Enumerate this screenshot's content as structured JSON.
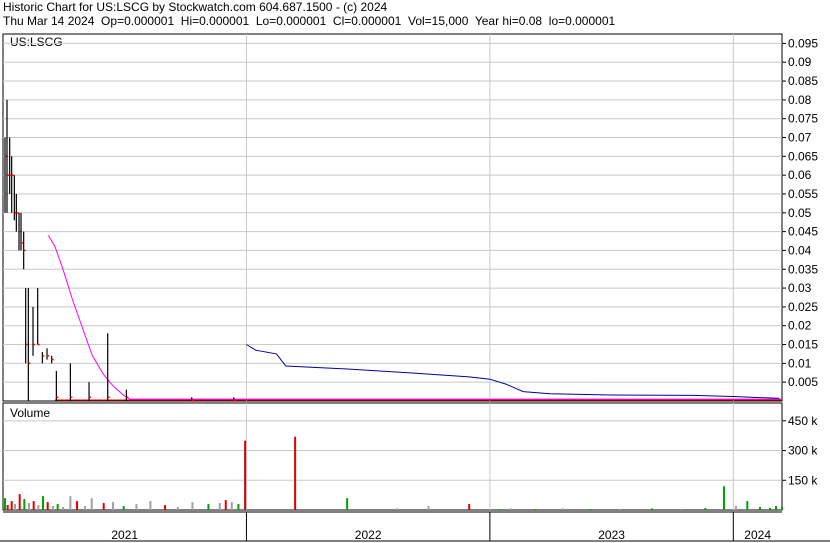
{
  "header": {
    "title": "Historic Chart for US:LSCG by Stockwatch.com 604.687.1500 - (c) 2024",
    "quote": "Thu Mar 14 2024  Op=0.000001  Hi=0.000001  Lo=0.000001  Cl=0.000001  Vol=15,000  Year hi=0.08  lo=0.000001"
  },
  "chart_data": {
    "type": "candlestick",
    "symbol_label": "US:LSCG",
    "volume_label": "Volume",
    "x_ticks": [
      "2021",
      "2022",
      "2023",
      "2024"
    ],
    "x_range": [
      "2021-01-01",
      "2024-03-14"
    ],
    "price_axis": {
      "ticks": [
        0.005,
        0.01,
        0.015,
        0.02,
        0.025,
        0.03,
        0.035,
        0.04,
        0.045,
        0.05,
        0.055,
        0.06,
        0.065,
        0.07,
        0.075,
        0.08,
        0.085,
        0.09,
        0.095
      ],
      "tick_labels": [
        "0.005",
        "0.01",
        "0.015",
        "0.02",
        "0.025",
        "0.03",
        "0.035",
        "0.04",
        "0.045",
        "0.05",
        "0.055",
        "0.06",
        "0.065",
        "0.07",
        "0.075",
        "0.08",
        "0.085",
        "0.09",
        "0.095"
      ],
      "ylim": [
        0,
        0.0975
      ]
    },
    "volume_axis": {
      "ticks": [
        150000,
        300000,
        450000
      ],
      "tick_labels": [
        "150 k",
        "300 k",
        "450 k"
      ],
      "ylim": [
        0,
        540000
      ]
    },
    "grid": true,
    "colors": {
      "bar": "#000000",
      "close_tick": "#ff0000",
      "ma_short": "#ff00ff",
      "ma_long": "#0000a0",
      "vol_up": "#00a000",
      "vol_down": "#e00000",
      "vol_flat": "#a0a0a0",
      "grid": "#c8c8c8"
    },
    "price_bars": [
      {
        "date": "2021-01-04",
        "high": 0.07,
        "low": 0.05,
        "close": 0.065
      },
      {
        "date": "2021-01-07",
        "high": 0.08,
        "low": 0.05,
        "close": 0.06
      },
      {
        "date": "2021-01-11",
        "high": 0.07,
        "low": 0.055,
        "close": 0.06
      },
      {
        "date": "2021-01-14",
        "high": 0.065,
        "low": 0.05,
        "close": 0.06
      },
      {
        "date": "2021-01-18",
        "high": 0.06,
        "low": 0.048,
        "close": 0.05
      },
      {
        "date": "2021-01-21",
        "high": 0.055,
        "low": 0.045,
        "close": 0.05
      },
      {
        "date": "2021-01-25",
        "high": 0.05,
        "low": 0.04,
        "close": 0.045
      },
      {
        "date": "2021-01-28",
        "high": 0.05,
        "low": 0.04,
        "close": 0.042
      },
      {
        "date": "2021-02-01",
        "high": 0.045,
        "low": 0.035,
        "close": 0.04
      },
      {
        "date": "2021-02-04",
        "high": 0.03,
        "low": 0.01,
        "close": 0.015
      },
      {
        "date": "2021-02-08",
        "high": 0.03,
        "low": 1e-06,
        "close": 0.01
      },
      {
        "date": "2021-02-15",
        "high": 0.025,
        "low": 0.012,
        "close": 0.015
      },
      {
        "date": "2021-02-22",
        "high": 0.03,
        "low": 0.015,
        "close": 0.015
      },
      {
        "date": "2021-03-01",
        "high": 0.013,
        "low": 0.01,
        "close": 0.012
      },
      {
        "date": "2021-03-08",
        "high": 0.014,
        "low": 0.011,
        "close": 0.012
      },
      {
        "date": "2021-03-15",
        "high": 0.012,
        "low": 0.01,
        "close": 0.011
      },
      {
        "date": "2021-03-22",
        "high": 0.008,
        "low": 1e-06,
        "close": 0.001
      },
      {
        "date": "2021-04-12",
        "high": 0.01,
        "low": 1e-06,
        "close": 0.001
      },
      {
        "date": "2021-05-10",
        "high": 0.005,
        "low": 1e-06,
        "close": 0.001
      },
      {
        "date": "2021-06-07",
        "high": 0.018,
        "low": 1e-06,
        "close": 0.001
      },
      {
        "date": "2021-07-05",
        "high": 0.003,
        "low": 1e-06,
        "close": 0.001
      },
      {
        "date": "2021-10-11",
        "high": 0.001,
        "low": 1e-06,
        "close": 1e-06
      },
      {
        "date": "2021-12-13",
        "high": 0.001,
        "low": 1e-06,
        "close": 1e-06
      }
    ],
    "flat_price": 1e-06,
    "ma_short": [
      {
        "date": "2021-03-10",
        "value": 0.044
      },
      {
        "date": "2021-03-20",
        "value": 0.041
      },
      {
        "date": "2021-04-01",
        "value": 0.035
      },
      {
        "date": "2021-04-15",
        "value": 0.027
      },
      {
        "date": "2021-05-01",
        "value": 0.019
      },
      {
        "date": "2021-05-15",
        "value": 0.012
      },
      {
        "date": "2021-06-01",
        "value": 0.007
      },
      {
        "date": "2021-06-15",
        "value": 0.004
      },
      {
        "date": "2021-07-01",
        "value": 0.0015
      },
      {
        "date": "2021-07-10",
        "value": 0.0005
      },
      {
        "date": "2024-03-14",
        "value": 0.0005
      }
    ],
    "ma_long": [
      {
        "date": "2022-01-01",
        "value": 0.015
      },
      {
        "date": "2022-01-15",
        "value": 0.0135
      },
      {
        "date": "2022-02-15",
        "value": 0.0125
      },
      {
        "date": "2022-03-01",
        "value": 0.0093
      },
      {
        "date": "2022-06-01",
        "value": 0.0085
      },
      {
        "date": "2022-09-01",
        "value": 0.0075
      },
      {
        "date": "2022-12-01",
        "value": 0.0064
      },
      {
        "date": "2023-01-01",
        "value": 0.0058
      },
      {
        "date": "2023-01-25",
        "value": 0.0045
      },
      {
        "date": "2023-02-20",
        "value": 0.0025
      },
      {
        "date": "2023-04-01",
        "value": 0.0019
      },
      {
        "date": "2023-07-01",
        "value": 0.0016
      },
      {
        "date": "2023-11-01",
        "value": 0.0015
      },
      {
        "date": "2024-01-01",
        "value": 0.0012
      },
      {
        "date": "2024-03-10",
        "value": 0.0007
      }
    ],
    "volume_bars": [
      {
        "date": "2021-01-04",
        "value": 60000,
        "dir": "up"
      },
      {
        "date": "2021-01-08",
        "value": 25000,
        "dir": "down"
      },
      {
        "date": "2021-01-14",
        "value": 45000,
        "dir": "down"
      },
      {
        "date": "2021-01-19",
        "value": 30000,
        "dir": "flat"
      },
      {
        "date": "2021-01-26",
        "value": 80000,
        "dir": "down"
      },
      {
        "date": "2021-02-02",
        "value": 55000,
        "dir": "up"
      },
      {
        "date": "2021-02-09",
        "value": 35000,
        "dir": "flat"
      },
      {
        "date": "2021-02-16",
        "value": 45000,
        "dir": "down"
      },
      {
        "date": "2021-02-23",
        "value": 25000,
        "dir": "flat"
      },
      {
        "date": "2021-03-02",
        "value": 70000,
        "dir": "up"
      },
      {
        "date": "2021-03-09",
        "value": 40000,
        "dir": "down"
      },
      {
        "date": "2021-03-17",
        "value": 20000,
        "dir": "flat"
      },
      {
        "date": "2021-03-24",
        "value": 30000,
        "dir": "up"
      },
      {
        "date": "2021-04-01",
        "value": 15000,
        "dir": "flat"
      },
      {
        "date": "2021-04-12",
        "value": 70000,
        "dir": "flat"
      },
      {
        "date": "2021-04-22",
        "value": 45000,
        "dir": "down"
      },
      {
        "date": "2021-05-04",
        "value": 20000,
        "dir": "flat"
      },
      {
        "date": "2021-05-14",
        "value": 60000,
        "dir": "flat"
      },
      {
        "date": "2021-06-01",
        "value": 35000,
        "dir": "down"
      },
      {
        "date": "2021-06-15",
        "value": 40000,
        "dir": "flat"
      },
      {
        "date": "2021-07-01",
        "value": 20000,
        "dir": "up"
      },
      {
        "date": "2021-07-20",
        "value": 30000,
        "dir": "flat"
      },
      {
        "date": "2021-08-10",
        "value": 45000,
        "dir": "flat"
      },
      {
        "date": "2021-09-01",
        "value": 25000,
        "dir": "down"
      },
      {
        "date": "2021-09-20",
        "value": 15000,
        "dir": "flat"
      },
      {
        "date": "2021-10-12",
        "value": 40000,
        "dir": "flat"
      },
      {
        "date": "2021-11-05",
        "value": 30000,
        "dir": "up"
      },
      {
        "date": "2021-11-22",
        "value": 35000,
        "dir": "flat"
      },
      {
        "date": "2021-12-01",
        "value": 50000,
        "dir": "down"
      },
      {
        "date": "2021-12-10",
        "value": 40000,
        "dir": "flat"
      },
      {
        "date": "2021-12-20",
        "value": 30000,
        "dir": "up"
      },
      {
        "date": "2021-12-30",
        "value": 350000,
        "dir": "down"
      },
      {
        "date": "2022-03-15",
        "value": 370000,
        "dir": "down"
      },
      {
        "date": "2022-06-01",
        "value": 60000,
        "dir": "up"
      },
      {
        "date": "2022-08-15",
        "value": 8000,
        "dir": "flat"
      },
      {
        "date": "2022-10-01",
        "value": 20000,
        "dir": "flat"
      },
      {
        "date": "2022-12-01",
        "value": 30000,
        "dir": "down"
      },
      {
        "date": "2023-01-15",
        "value": 5000,
        "dir": "up"
      },
      {
        "date": "2023-02-01",
        "value": 8000,
        "dir": "flat"
      },
      {
        "date": "2023-03-10",
        "value": 5000,
        "dir": "up"
      },
      {
        "date": "2023-04-20",
        "value": 8000,
        "dir": "flat"
      },
      {
        "date": "2023-06-01",
        "value": 5000,
        "dir": "up"
      },
      {
        "date": "2023-07-15",
        "value": 6000,
        "dir": "flat"
      },
      {
        "date": "2023-09-01",
        "value": 8000,
        "dir": "up"
      },
      {
        "date": "2023-10-15",
        "value": 5000,
        "dir": "flat"
      },
      {
        "date": "2023-11-20",
        "value": 10000,
        "dir": "up"
      },
      {
        "date": "2023-12-18",
        "value": 120000,
        "dir": "up"
      },
      {
        "date": "2024-01-05",
        "value": 20000,
        "dir": "flat"
      },
      {
        "date": "2024-01-22",
        "value": 45000,
        "dir": "up"
      },
      {
        "date": "2024-02-10",
        "value": 15000,
        "dir": "up"
      },
      {
        "date": "2024-02-25",
        "value": 10000,
        "dir": "up"
      },
      {
        "date": "2024-03-05",
        "value": 20000,
        "dir": "up"
      },
      {
        "date": "2024-03-14",
        "value": 15000,
        "dir": "up"
      }
    ]
  }
}
